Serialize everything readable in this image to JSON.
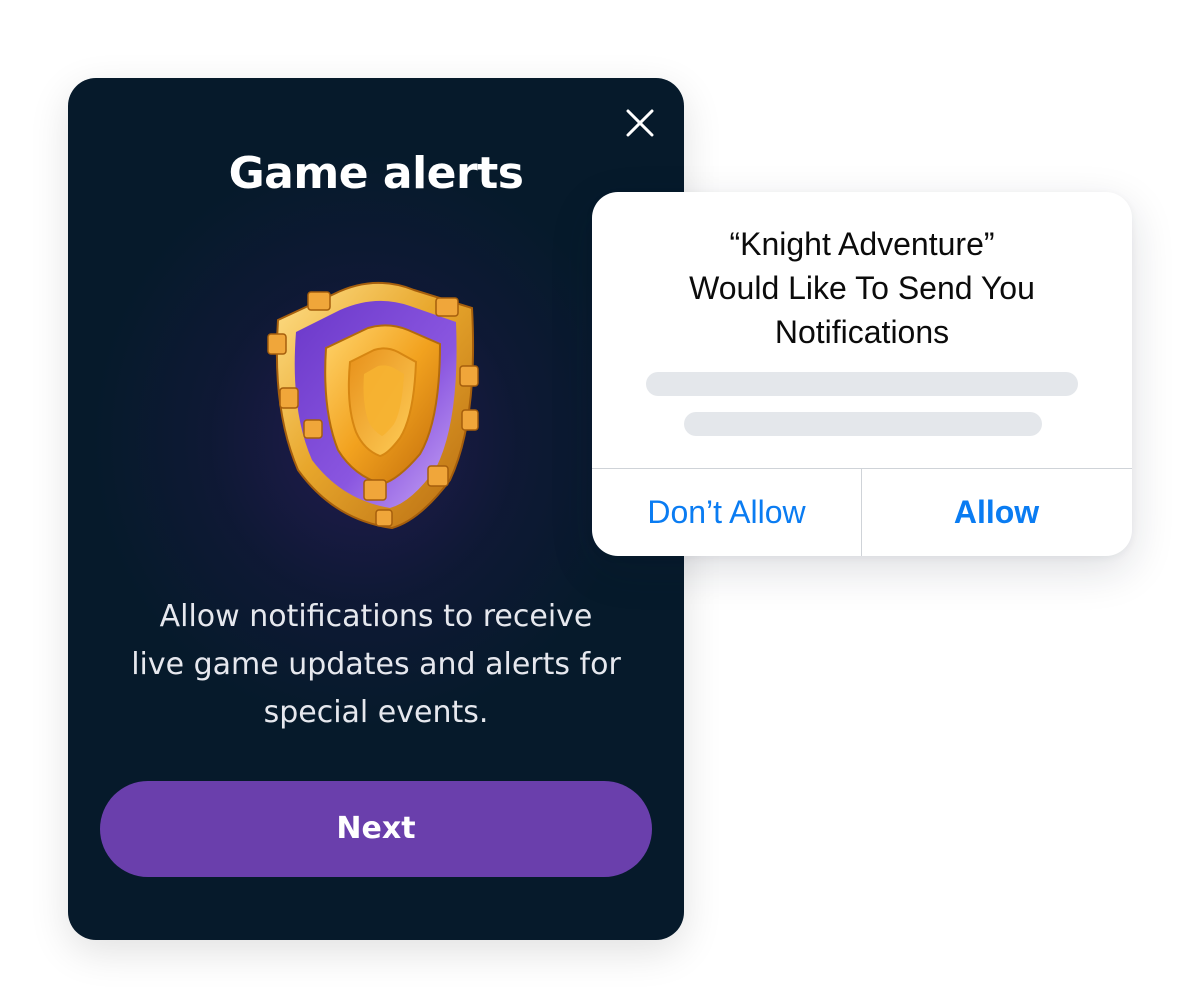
{
  "game_card": {
    "title": "Game alerts",
    "close_icon": "close-icon",
    "illustration": "shield-icon",
    "body_lines": [
      "Allow notifications to receive",
      "live game updates and alerts for",
      "special events."
    ],
    "next_label": "Next"
  },
  "ios_dialog": {
    "title_lines": [
      "“Knight Adventure”",
      "Would Like To Send You",
      "Notifications"
    ],
    "deny_label": "Don’t Allow",
    "allow_label": "Allow"
  },
  "colors": {
    "card_background": "#061a2b",
    "primary_button": "#6a3fac",
    "ios_link": "#0a7cf2",
    "skeleton": "#e4e7eb"
  }
}
